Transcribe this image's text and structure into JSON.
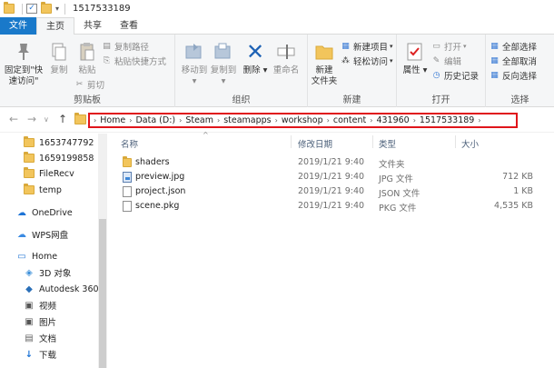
{
  "window": {
    "title": "1517533189"
  },
  "tabs": {
    "file": "文件",
    "home": "主页",
    "share": "共享",
    "view": "查看"
  },
  "ribbon": {
    "clipboard": {
      "pin": "固定到\"快\n速访问\"",
      "copy": "复制",
      "paste": "粘贴",
      "copy_path": "复制路径",
      "paste_shortcut": "粘贴快捷方式",
      "cut": "剪切",
      "label": "剪贴板"
    },
    "organize": {
      "move_to": "移动到",
      "copy_to": "复制到",
      "delete": "删除",
      "rename": "重命名",
      "label": "组织"
    },
    "new": {
      "new_folder": "新建\n文件夹",
      "new_item": "新建项目",
      "easy_access": "轻松访问",
      "label": "新建"
    },
    "open": {
      "properties": "属性",
      "open": "打开",
      "edit": "编辑",
      "history": "历史记录",
      "label": "打开"
    },
    "select": {
      "select_all": "全部选择",
      "select_none": "全部取消",
      "invert": "反向选择",
      "label": "选择"
    }
  },
  "breadcrumb": [
    "Home",
    "Data (D:)",
    "Steam",
    "steamapps",
    "workshop",
    "content",
    "431960",
    "1517533189"
  ],
  "sidebar": {
    "items": [
      {
        "label": "1653747792",
        "icon": "folder-icon"
      },
      {
        "label": "1659199858",
        "icon": "folder-icon"
      },
      {
        "label": "FileRecv",
        "icon": "folder-icon"
      },
      {
        "label": "temp",
        "icon": "folder-icon"
      },
      {
        "label": "OneDrive",
        "icon": "cloud-icon"
      },
      {
        "label": "WPS网盘",
        "icon": "wps-cloud-icon"
      },
      {
        "label": "Home",
        "icon": "computer-icon"
      },
      {
        "label": "3D 对象",
        "icon": "3d-objects-icon"
      },
      {
        "label": "Autodesk 360",
        "icon": "autodesk-icon"
      },
      {
        "label": "视频",
        "icon": "video-icon"
      },
      {
        "label": "图片",
        "icon": "pictures-icon"
      },
      {
        "label": "文档",
        "icon": "documents-icon"
      },
      {
        "label": "下载",
        "icon": "download-icon"
      }
    ]
  },
  "columns": {
    "name": "名称",
    "date": "修改日期",
    "type": "类型",
    "size": "大小"
  },
  "files": [
    {
      "name": "shaders",
      "date": "2019/1/21 9:40",
      "type": "文件夹",
      "size": "",
      "icon": "folder-icon"
    },
    {
      "name": "preview.jpg",
      "date": "2019/1/21 9:40",
      "type": "JPG 文件",
      "size": "712 KB",
      "icon": "image-file-icon"
    },
    {
      "name": "project.json",
      "date": "2019/1/21 9:40",
      "type": "JSON 文件",
      "size": "1 KB",
      "icon": "document-icon"
    },
    {
      "name": "scene.pkg",
      "date": "2019/1/21 9:40",
      "type": "PKG 文件",
      "size": "4,535 KB",
      "icon": "document-icon"
    }
  ],
  "colors": {
    "file_tab": "#1979ca",
    "address_highlight": "#e0151b",
    "folder": "#f2c55c"
  }
}
